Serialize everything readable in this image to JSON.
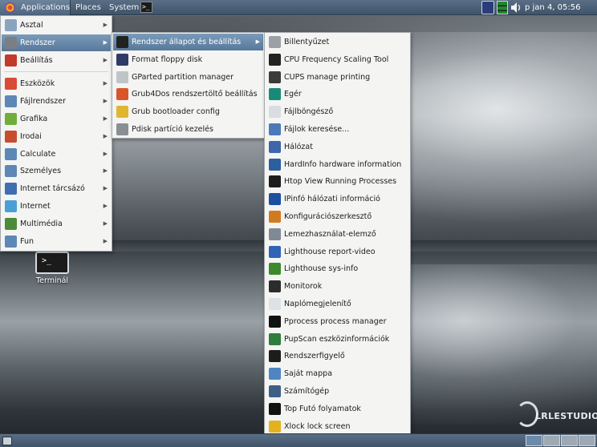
{
  "top_panel": {
    "applications_label": "Applications",
    "places_label": "Places",
    "system_label": "System",
    "terminal_launcher_glyph": ">_",
    "clock": "p jan  4, 05:56"
  },
  "menu_level1": [
    {
      "label": "Asztal",
      "icon": "desktop-icon",
      "color": "#8aa4c0"
    },
    {
      "label": "Rendszer",
      "icon": "system-icon",
      "color": "#7a7f86",
      "active": true
    },
    {
      "label": "Beállítás",
      "icon": "settings-icon",
      "color": "#c23a2a"
    },
    {
      "label": "Eszközök",
      "icon": "tools-icon",
      "color": "#d84b35"
    },
    {
      "label": "Fájlrendszer",
      "icon": "folder-icon",
      "color": "#5d87b6"
    },
    {
      "label": "Grafika",
      "icon": "graphics-icon",
      "color": "#6fae3a"
    },
    {
      "label": "Irodai",
      "icon": "office-icon",
      "color": "#c84d2f"
    },
    {
      "label": "Calculate",
      "icon": "calculator-folder-icon",
      "color": "#5d87b6"
    },
    {
      "label": "Személyes",
      "icon": "personal-folder-icon",
      "color": "#5d87b6"
    },
    {
      "label": "Internet tárcsázó",
      "icon": "dialer-icon",
      "color": "#3f6fb0"
    },
    {
      "label": "Internet",
      "icon": "globe-icon",
      "color": "#4aa0d6"
    },
    {
      "label": "Multimédia",
      "icon": "multimedia-icon",
      "color": "#4c8a3a"
    },
    {
      "label": "Fun",
      "icon": "fun-folder-icon",
      "color": "#5d87b6"
    }
  ],
  "menu_level2": [
    {
      "label": "Rendszer állapot és beállítás",
      "icon": "terminal-icon",
      "color": "#222222",
      "active": true
    },
    {
      "label": "Format floppy disk",
      "icon": "floppy-icon",
      "color": "#2f3a66"
    },
    {
      "label": "GParted partition manager",
      "icon": "gparted-icon",
      "color": "#bfc4c9"
    },
    {
      "label": "Grub4Dos rendszertöltő beállítás",
      "icon": "grub4dos-icon",
      "color": "#d9562a"
    },
    {
      "label": "Grub bootloader config",
      "icon": "grub-icon",
      "color": "#e0b62e"
    },
    {
      "label": "Pdisk partíció kezelés",
      "icon": "disk-icon",
      "color": "#8a8f94"
    }
  ],
  "menu_level3": [
    {
      "label": "Billentyűzet",
      "icon": "keyboard-icon",
      "color": "#9aa0a5"
    },
    {
      "label": "CPU Frequency Scaling Tool",
      "icon": "cpu-icon",
      "color": "#222222"
    },
    {
      "label": "CUPS manage printing",
      "icon": "printer-icon",
      "color": "#3b3b3b"
    },
    {
      "label": "Egér",
      "icon": "mouse-icon",
      "color": "#1a8a78"
    },
    {
      "label": "Fájlböngésző",
      "icon": "file-browser-icon",
      "color": "#d9dde0"
    },
    {
      "label": "Fájlok keresése...",
      "icon": "search-files-icon",
      "color": "#4a79b8"
    },
    {
      "label": "Hálózat",
      "icon": "network-icon",
      "color": "#3e66a8"
    },
    {
      "label": "HardInfo hardware information",
      "icon": "hardinfo-icon",
      "color": "#2d5f9e"
    },
    {
      "label": "Htop View Running Processes",
      "icon": "htop-icon",
      "color": "#1c1c1c"
    },
    {
      "label": "IPinfó hálózati információ",
      "icon": "ipinfo-icon",
      "color": "#1c4fa0"
    },
    {
      "label": "Konfigurációszerkesztő",
      "icon": "config-editor-icon",
      "color": "#d27a22"
    },
    {
      "label": "Lemezhasználat-elemző",
      "icon": "disk-usage-icon",
      "color": "#7f8a95"
    },
    {
      "label": "Lighthouse report-video",
      "icon": "report-video-icon",
      "color": "#2f63b5"
    },
    {
      "label": "Lighthouse sys-info",
      "icon": "sys-info-icon",
      "color": "#3c8a2c"
    },
    {
      "label": "Monitorok",
      "icon": "monitor-icon",
      "color": "#2c2c2c"
    },
    {
      "label": "Naplómegjelenítő",
      "icon": "log-viewer-icon",
      "color": "#dfe2e4"
    },
    {
      "label": "Pprocess process manager",
      "icon": "pprocess-icon",
      "color": "#111111"
    },
    {
      "label": "PupScan eszközinformációk",
      "icon": "pupscan-icon",
      "color": "#2f7d3a"
    },
    {
      "label": "Rendszerfigyelő",
      "icon": "system-monitor-icon",
      "color": "#1d1d1d"
    },
    {
      "label": "Saját mappa",
      "icon": "home-folder-icon",
      "color": "#4f86c2"
    },
    {
      "label": "Számítógép",
      "icon": "computer-icon",
      "color": "#3f5f85"
    },
    {
      "label": "Top Futó folyamatok",
      "icon": "top-processes-icon",
      "color": "#111111"
    },
    {
      "label": "Xlock lock screen",
      "icon": "lock-screen-icon",
      "color": "#e4b21e"
    }
  ],
  "desktop": {
    "terminal_label": "Terminál",
    "terminal_glyph": ">_"
  },
  "watermark": "LRLESTUDIO"
}
